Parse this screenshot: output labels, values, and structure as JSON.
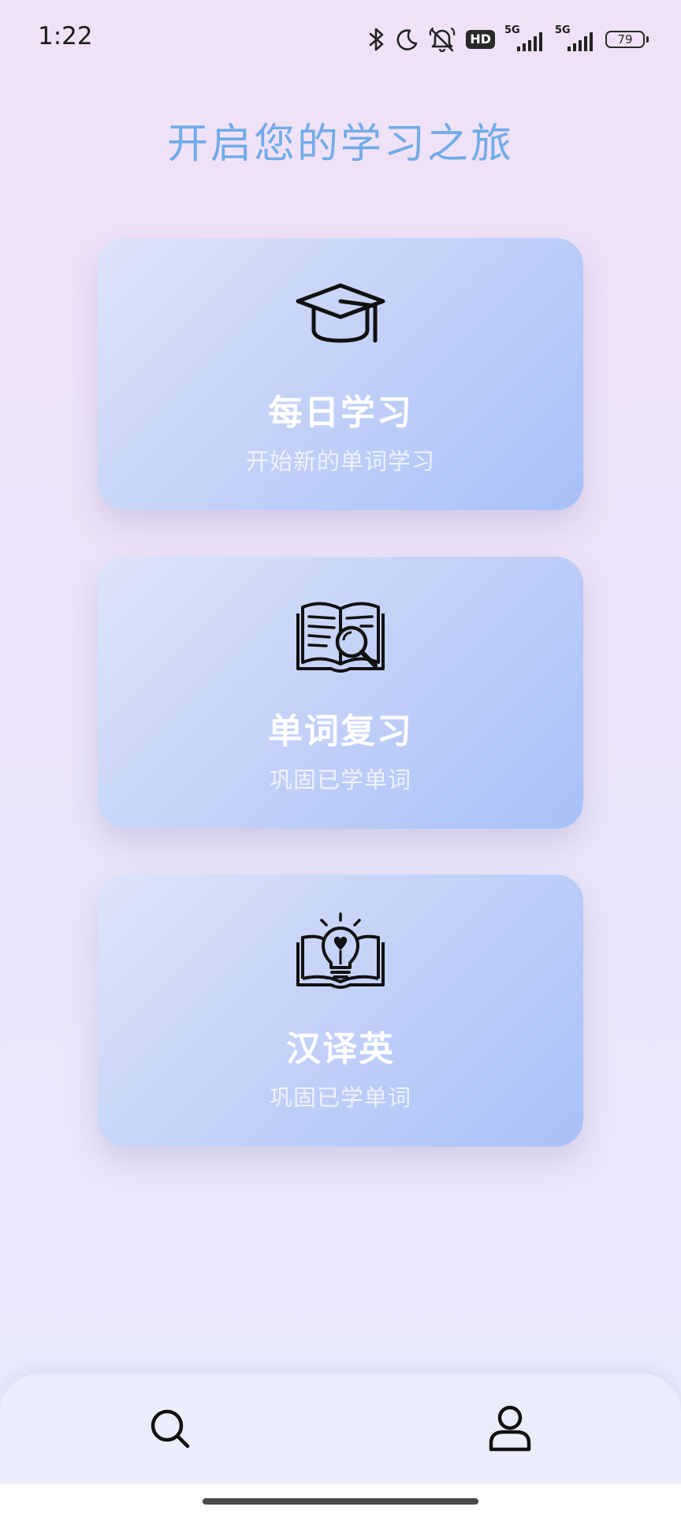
{
  "status_bar": {
    "time": "1:22",
    "hd_label": "HD",
    "network_1": "5G",
    "network_2": "5G",
    "battery_level": "79",
    "icons": [
      "bluetooth-icon",
      "moon-icon",
      "silent-bell-icon",
      "hd-icon",
      "signal-icon",
      "signal-icon",
      "battery-icon"
    ]
  },
  "page": {
    "title": "开启您的学习之旅"
  },
  "cards": [
    {
      "icon": "graduation-cap-icon",
      "title": "每日学习",
      "subtitle": "开始新的单词学习"
    },
    {
      "icon": "book-search-icon",
      "title": "单词复习",
      "subtitle": "巩固已学单词"
    },
    {
      "icon": "book-lightbulb-icon",
      "title": "汉译英",
      "subtitle": "巩固已学单词"
    }
  ],
  "bottom_nav": {
    "items": [
      {
        "icon": "search-icon",
        "name": "search"
      },
      {
        "icon": "user-icon",
        "name": "profile"
      }
    ]
  },
  "colors": {
    "title": "#72ace8",
    "card_gradient_start": "#dce4f9",
    "card_gradient_end": "#a8c0f8",
    "card_text": "#ffffff"
  }
}
